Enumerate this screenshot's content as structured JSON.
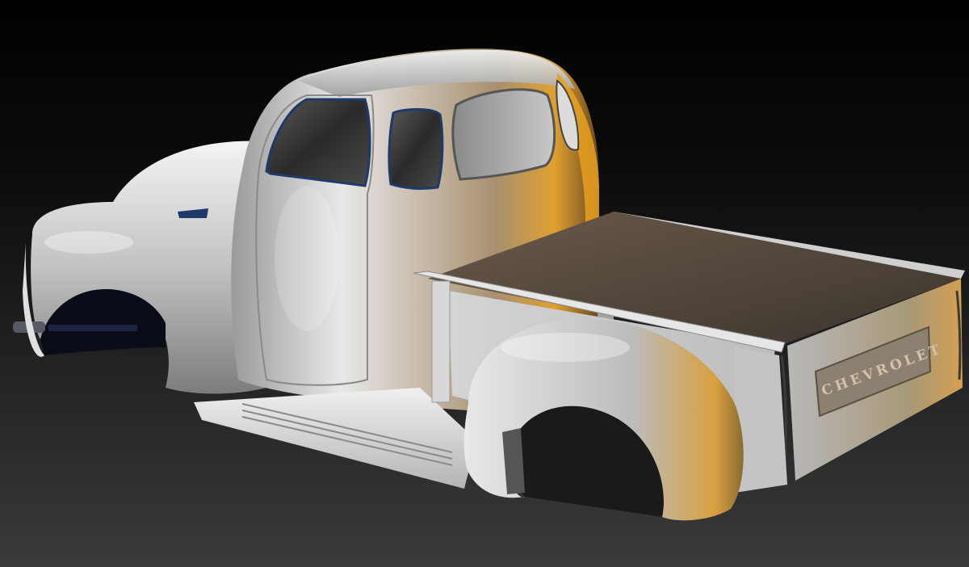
{
  "scene": {
    "background_top": "#000000",
    "background_bottom": "#3a3a3a",
    "body_color": "#c8c8c8",
    "highlight_color": "#ffffff",
    "warm_light_color": "#e8a020",
    "trim_color": "#1e3a6a"
  },
  "tailgate": {
    "emblem": "CHEVROLET"
  }
}
